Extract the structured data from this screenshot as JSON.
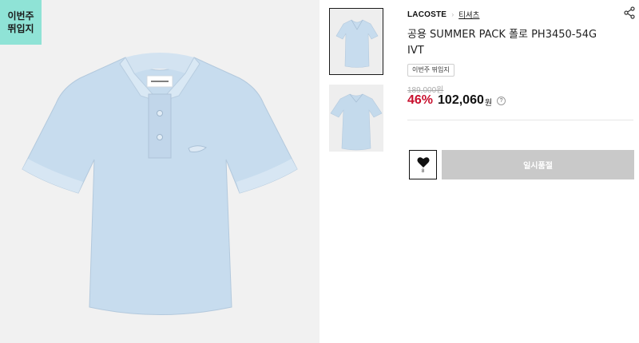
{
  "badge": {
    "line1": "이번주",
    "line2": "뛰입지"
  },
  "product": {
    "brand": "LACOSTE",
    "breadcrumb_separator": "›",
    "category": "티셔츠",
    "title": "공용 SUMMER PACK 폴로 PH3450-54G IVT",
    "tag": "이번주 뛰입지",
    "original_price": "189,000원",
    "discount": "46%",
    "price": "102,060",
    "currency": "원",
    "help_symbol": "?"
  },
  "actions": {
    "wishlist_count": "8",
    "soldout_label": "일시품절"
  },
  "icons": {
    "share": "share-icon",
    "heart": "heart-icon",
    "help": "help-icon"
  },
  "colors": {
    "accent_badge": "#8fe3d6",
    "discount": "#c8102e",
    "shirt": "#c7dcee",
    "disabled_button": "#c9c9c9"
  }
}
